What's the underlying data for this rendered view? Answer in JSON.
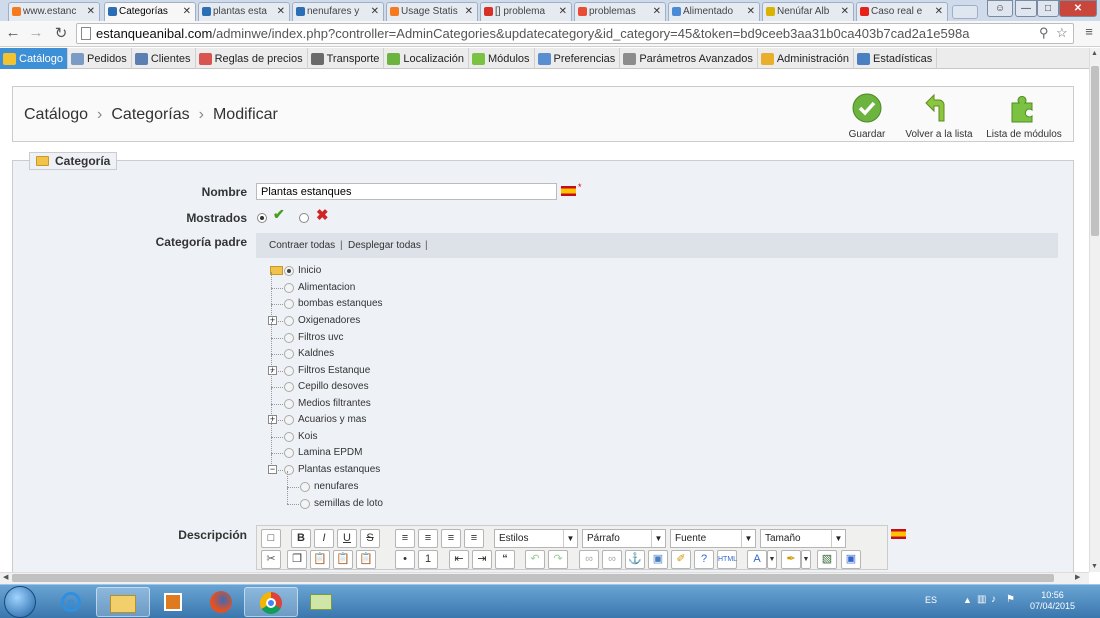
{
  "browser": {
    "tabs": [
      {
        "label": "www.estanc",
        "color": "#f57a1f"
      },
      {
        "label": "Categorías",
        "color": "#2a6fb5"
      },
      {
        "label": "plantas esta",
        "color": "#2a6fb5"
      },
      {
        "label": "nenufares y",
        "color": "#2a6fb5"
      },
      {
        "label": "Usage Statis",
        "color": "#f57a1f"
      },
      {
        "label": "[] problema",
        "color": "#d93025"
      },
      {
        "label": "problemas",
        "color": "#e94b35"
      },
      {
        "label": "Alimentado",
        "color": "#4b8bd6"
      },
      {
        "label": "Nenúfar Alb",
        "color": "#d9b300"
      },
      {
        "label": "Caso real e",
        "color": "#e62117"
      }
    ],
    "url_domain": "estanqueanibal.com",
    "url_path": "/adminwe/index.php?controller=AdminCategories&updatecategory&id_category=45&token=bd9ceeb3aa31b0ca403b7cad2a1e598a"
  },
  "menu": [
    {
      "label": "Catálogo",
      "active": true,
      "color": "#f2c230"
    },
    {
      "label": "Pedidos",
      "active": false,
      "color": "#7a9bc4"
    },
    {
      "label": "Clientes",
      "active": false,
      "color": "#5b7fb0"
    },
    {
      "label": "Reglas de precios",
      "active": false,
      "color": "#d9534f"
    },
    {
      "label": "Transporte",
      "active": false,
      "color": "#6a6a6a"
    },
    {
      "label": "Localización",
      "active": false,
      "color": "#6db33f"
    },
    {
      "label": "Módulos",
      "active": false,
      "color": "#7cc242"
    },
    {
      "label": "Preferencias",
      "active": false,
      "color": "#5a8fcf"
    },
    {
      "label": "Parámetros Avanzados",
      "active": false,
      "color": "#8c8c8c"
    },
    {
      "label": "Administración",
      "active": false,
      "color": "#e8b02a"
    },
    {
      "label": "Estadísticas",
      "active": false,
      "color": "#4a7fc1"
    }
  ],
  "breadcrumb": [
    "Catálogo",
    "Categorías",
    "Modificar"
  ],
  "toolbar": {
    "save": "Guardar",
    "back": "Volver a la lista",
    "modules": "Lista de módulos"
  },
  "form": {
    "legend": "Categoría",
    "name_label": "Nombre",
    "name_value": "Plantas estanques",
    "shown_label": "Mostrados",
    "parent_label": "Categoría padre",
    "collapse_all": "Contraer todas",
    "expand_all": "Desplegar todas",
    "description_label": "Descripción"
  },
  "tree": [
    {
      "label": "Inicio",
      "level": 0,
      "selected": true,
      "expandable": false,
      "root": true
    },
    {
      "label": "Alimentacion",
      "level": 1,
      "expandable": false
    },
    {
      "label": "bombas estanques",
      "level": 1,
      "expandable": false
    },
    {
      "label": "Oxigenadores",
      "level": 1,
      "expandable": true,
      "sign": "+"
    },
    {
      "label": "Filtros uvc",
      "level": 1,
      "expandable": false
    },
    {
      "label": "Kaldnes",
      "level": 1,
      "expandable": false
    },
    {
      "label": "Filtros Estanque",
      "level": 1,
      "expandable": true,
      "sign": "+"
    },
    {
      "label": "Cepillo desoves",
      "level": 1,
      "expandable": false
    },
    {
      "label": "Medios filtrantes",
      "level": 1,
      "expandable": false
    },
    {
      "label": "Acuarios y mas",
      "level": 1,
      "expandable": true,
      "sign": "+"
    },
    {
      "label": "Kois",
      "level": 1,
      "expandable": false
    },
    {
      "label": "Lamina EPDM",
      "level": 1,
      "expandable": false
    },
    {
      "label": "Plantas estanques",
      "level": 1,
      "expandable": true,
      "sign": "−"
    },
    {
      "label": "nenufares",
      "level": 2,
      "expandable": false
    },
    {
      "label": "semillas de loto",
      "level": 2,
      "expandable": false
    }
  ],
  "editor": {
    "styles": "Estilos",
    "paragraph": "Párrafo",
    "font": "Fuente",
    "size": "Tamaño"
  },
  "taskbar": {
    "lang": "ES",
    "time": "10:56",
    "date": "07/04/2015"
  }
}
